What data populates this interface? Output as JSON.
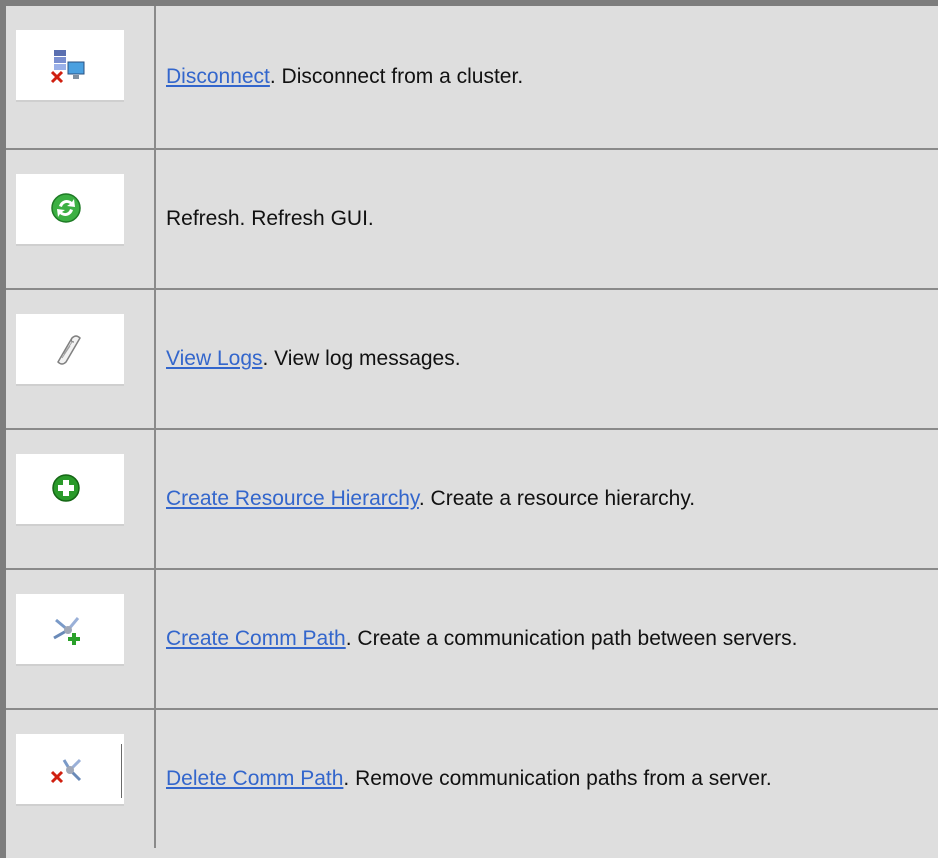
{
  "rows": [
    {
      "icon": "disconnect-server-icon",
      "link": "Disconnect",
      "rest": ". Disconnect from a cluster.",
      "linked": true
    },
    {
      "icon": "refresh-icon",
      "link": "",
      "rest": "Refresh.  Refresh GUI.",
      "linked": false
    },
    {
      "icon": "log-scroll-icon",
      "link": "View Logs",
      "rest": ". View log messages.",
      "linked": true
    },
    {
      "icon": "add-green-circle-icon",
      "link": "Create Resource Hierarchy",
      "rest": ". Create a resource hierarchy.",
      "linked": true
    },
    {
      "icon": "create-comm-path-icon",
      "link": "Create Comm Path",
      "rest": ". Create a communication path between servers.",
      "linked": true
    },
    {
      "icon": "delete-comm-path-icon",
      "link": "Delete Comm Path",
      "rest": ". Remove communication paths from a server.",
      "linked": true
    }
  ]
}
